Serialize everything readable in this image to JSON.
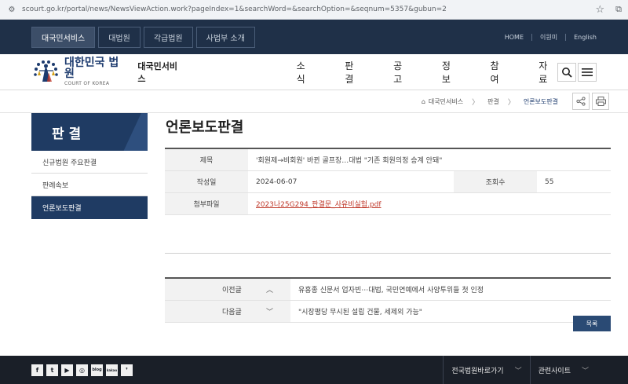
{
  "browser": {
    "url": "scourt.go.kr/portal/news/NewsViewAction.work?pageIndex=1&searchWord=&searchOption=&seqnum=5357&gubun=2"
  },
  "topbar": {
    "tabs": [
      "대국민서비스",
      "대법원",
      "각급법원",
      "사법부 소개"
    ],
    "links": [
      "HOME",
      "이원미",
      "English"
    ]
  },
  "header": {
    "logo_main": "대한민국 법원",
    "logo_sub": "COURT OF KOREA",
    "section": "대국민서비스",
    "gnb": [
      "소식",
      "판결",
      "공고",
      "정보",
      "참여",
      "자료"
    ]
  },
  "breadcrumb": {
    "items": [
      "대국민서비스",
      "판결",
      "언론보도판결"
    ]
  },
  "lnb": {
    "title": "판 결",
    "items": [
      "신규법원 주요판결",
      "판례속보",
      "언론보도판결"
    ]
  },
  "main": {
    "title": "언론보도판결",
    "labels": {
      "subject": "제목",
      "date": "작성일",
      "views": "조회수",
      "attachment": "첨부파일"
    },
    "subject": "'회원제→비회원' 바뀐 골프장…대법 \"기존 회원의정 승계 안돼\"",
    "date": "2024-06-07",
    "views": "55",
    "attachment": "2023나25G294_판결문_사유비실험.pdf",
    "prev_label": "이전글",
    "prev_title": "유흥종 신문서 업자빈⋯대법, 국민연예에서 사양투위들 첫 인정",
    "next_label": "다음글",
    "next_title": "\"시장평당 무시된 설립 건물, 세제외 가능\"",
    "list_button": "목록"
  },
  "footer": {
    "sns": [
      "f",
      "t",
      "▶",
      "◎",
      "blog",
      "kakao",
      "❜"
    ],
    "selects": [
      "전국법원바로가기",
      "관련사이트"
    ]
  }
}
